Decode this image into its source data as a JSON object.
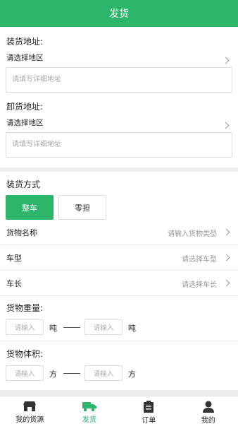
{
  "header": {
    "title": "发货"
  },
  "loading": {
    "title": "装货地址:",
    "region": "请选择地区",
    "detail_placeholder": "请填写详细地址"
  },
  "unloading": {
    "title": "卸货地址:",
    "region": "请选择地区",
    "detail_placeholder": "请填写详细地址"
  },
  "mode": {
    "title": "装货方式",
    "options": [
      "整车",
      "零担"
    ],
    "selected": "整车"
  },
  "fields": [
    {
      "label": "货物名称",
      "placeholder": "请输入货物类型"
    },
    {
      "label": "车型",
      "placeholder": "请选择车型"
    },
    {
      "label": "车长",
      "placeholder": "请选择车长"
    }
  ],
  "weight": {
    "title": "货物重量:",
    "min_placeholder": "请输入",
    "max_placeholder": "请输入",
    "unit": "吨"
  },
  "volume": {
    "title": "货物体积:",
    "min_placeholder": "请输入",
    "max_placeholder": "请输入",
    "unit": "方"
  },
  "tabbar": {
    "items": [
      {
        "label": "我的货源",
        "icon": "shop-icon"
      },
      {
        "label": "发货",
        "icon": "truck-icon"
      },
      {
        "label": "订单",
        "icon": "clipboard-icon"
      },
      {
        "label": "我的",
        "icon": "person-icon"
      }
    ],
    "active": "发货"
  },
  "colors": {
    "accent": "#2db56b",
    "divider": "#eeeeee"
  }
}
